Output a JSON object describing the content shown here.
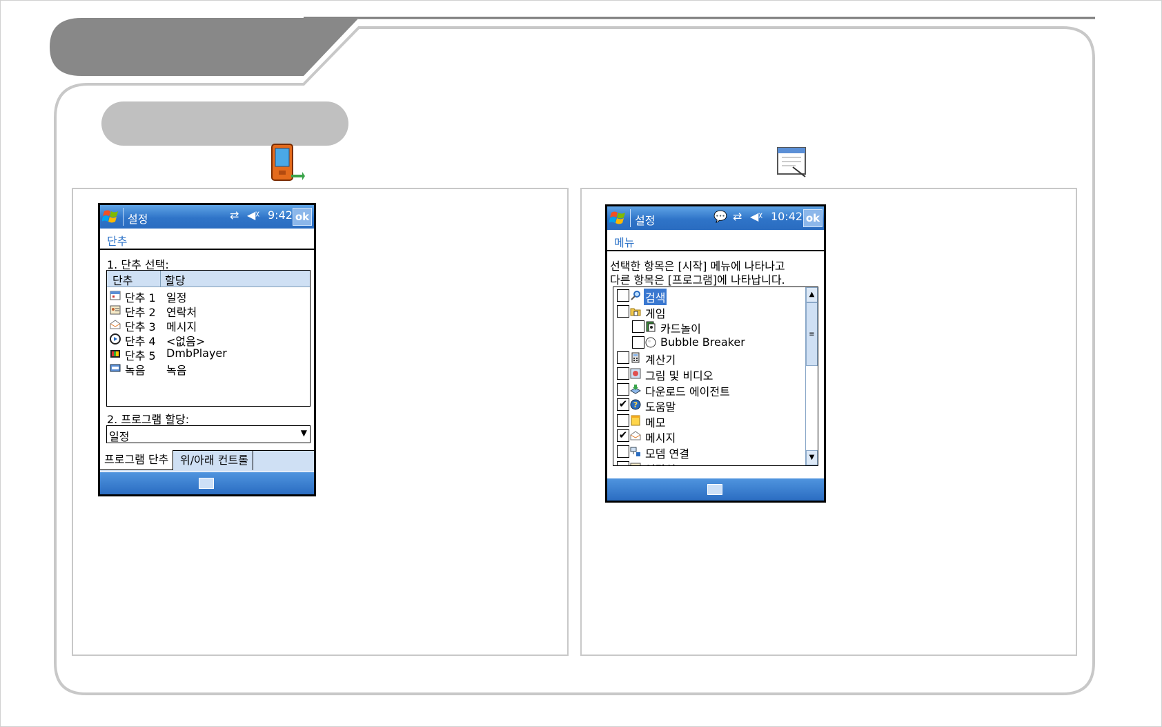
{
  "left_panel": {
    "device": {
      "title": "설정",
      "status_time": "9:42",
      "ok_label": "ok",
      "header": "단추",
      "section1_label": "1. 단추 선택:",
      "columns": [
        "단추",
        "할당"
      ],
      "rows": [
        {
          "button": "단추 1",
          "assignment": "일정",
          "icon": "calendar-icon"
        },
        {
          "button": "단추 2",
          "assignment": "연락처",
          "icon": "contacts-icon"
        },
        {
          "button": "단추 3",
          "assignment": "메시지",
          "icon": "messaging-icon"
        },
        {
          "button": "단추 4",
          "assignment": "<없음>",
          "icon": "media-player-icon"
        },
        {
          "button": "단추 5",
          "assignment": "DmbPlayer",
          "icon": "tv-icon"
        },
        {
          "button": "녹음",
          "assignment": "녹음",
          "icon": "recorder-icon"
        }
      ],
      "section2_label": "2. 프로그램 할당:",
      "program_select_value": "일정",
      "tabs": [
        "프로그램 단추",
        "위/아래 컨트롤"
      ]
    }
  },
  "right_panel": {
    "device": {
      "title": "설정",
      "status_time": "10:42",
      "ok_label": "ok",
      "header": "메뉴",
      "description_line1": "선택한 항목은 [시작] 메뉴에 나타나고",
      "description_line2": "다른 항목은 [프로그램]에 나타납니다.",
      "items": [
        {
          "label": "검색",
          "checked": false,
          "indent": 0,
          "selected": true,
          "icon": "search-icon"
        },
        {
          "label": "게임",
          "checked": false,
          "indent": 0,
          "selected": false,
          "icon": "games-folder-icon"
        },
        {
          "label": "카드놀이",
          "checked": false,
          "indent": 1,
          "selected": false,
          "icon": "solitaire-icon"
        },
        {
          "label": "Bubble Breaker",
          "checked": false,
          "indent": 1,
          "selected": false,
          "icon": "bubble-icon"
        },
        {
          "label": "계산기",
          "checked": false,
          "indent": 0,
          "selected": false,
          "icon": "calculator-icon"
        },
        {
          "label": "그림 및 비디오",
          "checked": false,
          "indent": 0,
          "selected": false,
          "icon": "pictures-icon"
        },
        {
          "label": "다운로드 에이전트",
          "checked": false,
          "indent": 0,
          "selected": false,
          "icon": "download-icon"
        },
        {
          "label": "도움말",
          "checked": true,
          "indent": 0,
          "selected": false,
          "icon": "help-icon"
        },
        {
          "label": "메모",
          "checked": false,
          "indent": 0,
          "selected": false,
          "icon": "notes-icon"
        },
        {
          "label": "메시지",
          "checked": true,
          "indent": 0,
          "selected": false,
          "icon": "messaging-icon"
        },
        {
          "label": "모뎀 연결",
          "checked": false,
          "indent": 0,
          "selected": false,
          "icon": "modem-icon"
        },
        {
          "label": "연락처",
          "checked": false,
          "indent": 0,
          "selected": false,
          "icon": "contacts-icon"
        }
      ]
    }
  },
  "colors": {
    "titlebar_blue": "#2f74c8",
    "selection_blue": "#3a78d0",
    "header_gray": "#888888"
  }
}
